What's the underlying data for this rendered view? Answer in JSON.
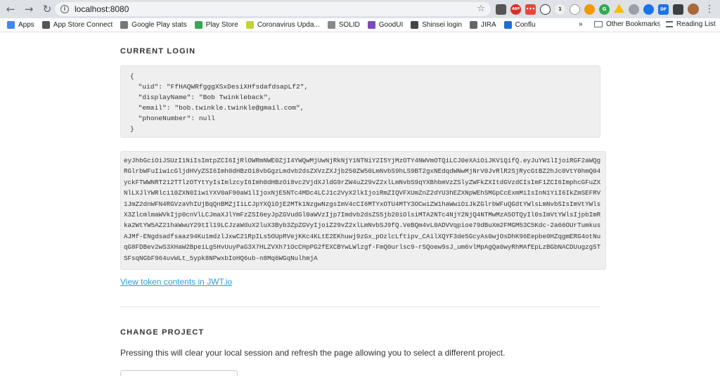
{
  "browser": {
    "url": "localhost:8080",
    "bookmarks": [
      {
        "label": "Apps",
        "color": "#4285f4"
      },
      {
        "label": "App Store Connect",
        "color": "#555555"
      },
      {
        "label": "Google Play stats",
        "color": "#777777"
      },
      {
        "label": "Play Store",
        "color": "#34a853"
      },
      {
        "label": "Coronavirus Upda...",
        "color": "#c5d23a"
      },
      {
        "label": "SOLID",
        "color": "#888888"
      },
      {
        "label": "GoodUI",
        "color": "#7b4bb8"
      },
      {
        "label": "Shinsei login",
        "color": "#444444"
      },
      {
        "label": "JIRA",
        "color": "#666666"
      },
      {
        "label": "Conflu",
        "color": "#1f6fd1"
      }
    ],
    "more_bookmarks": "»",
    "other_bookmarks": "Other Bookmarks",
    "reading_list": "Reading List",
    "ext_badge": "1",
    "ext_abp": "ABP",
    "ext_df": "DF"
  },
  "login": {
    "title": "CURRENT LOGIN",
    "json": "{\n  \"uid\": \"FfHAQWRfgggXSxDesiXHfsdafdsapLf2\",\n  \"displayName\": \"Bob Twinkleback\",\n  \"email\": \"bob.twinkle.twinkle@gmail.com\",\n  \"phoneNumber\": null\n}",
    "jwt": "eyJhbGciOiJSUzI1NiIsImtpZCI6IjRlOWRmNWE0ZjI4YWQwMjUwNjRkNjY1NTNiY2I5YjMzOTY4NWVmOTQiLCJ0eXAiOiJKV1QifQ.eyJuYW1lIjoiRGF2aWQgRGlrbWFuIiwicGljdHVyZSI6Imh0dHBzOi8vbGgzLmdvb2dsZXVzZXJjb250ZW50LmNvbS9hLS9BT2gxNEdqdWNwMjNrV0JvRlR2SjRycGtBZ2hJc0VtY0hmQ04yckFTWWNRT212TTlzOTYtYyIsImlzcyI6Imh0dHBzOi8vc2VjdXJldG9rZW4uZ29vZ2xlLmNvbS9qYXBhbmVzZSlyZWFkZXItdGVzdCIsImF1ZCI6ImphcGFuZXNlLXJlYWRlci10ZXN0IiwiYXV0aF90aW1lIjoxNjE5NTc4MDc4LCJ1c2VyX2lkIjoiRmZIQVFXUmZnZ2dYU3hEZXNpWEhSMGpCcExmMiIsInN1YiI6IkZmSEFRV1JmZ2dnWFN4RGVzaVhIUjBqQnBMZjIiLCJpYXQiOjE2MTk1NzgwNzgsImV4cCI6MTYxOTU4MTY3OCwiZW1haWwiOiJkZGlrbWFuQGdtYWlsLmNvbSIsImVtYWlsX3ZlcmlmaWVkIjp0cnVlLCJmaXJlYmFzZSI6eyJpZGVudGl0aWVzIjp7Imdvb2dsZS5jb20iOlsiMTA2NTc4NjY2NjQ4NTMwMzA5OTQyIl0sImVtYWlsIjpbImRka2WtYW5AZ21haWwuY29tIl19LCJzaWduX2luX3Byb3ZpZGVyIjoiZ29vZ2xlLmNvbSJ9fQ.VeBQm4vL0ADVVqpioe79dBuXm2FMGM53C5Kdc-2a66OUrTumkusAJMf-ENgdsadfsaaz94Ku1mdzlJxwC21RpILs5OUpRVejKKc4KLtE2EKhuwj9zGx_pOzlcLftipv_CAilXQYF3de5GcyAs0wjOsDhK96Eepbe0HZqgmERG4otNuqG8FDBev2wS3XHaW2BpeiLg5HvUuyPaG3X7HLZVXh71OcCHpPG2fEXCBYwLWlzgf-FmQ0urlsc9-rSQoew9sJ_um6vlMpAgQa0wyRhMAfEpLzBGbNACDUugzg5TSFsqNGbF964uvWLt_5ypk8NPwxbIoHQ6ub-n8Mq6WGqNulhmjA",
    "jwt_link": "View token contents in JWT.io"
  },
  "project": {
    "title": "CHANGE PROJECT",
    "description": "Pressing this will clear your local session and refresh the page allowing you to select a different project."
  }
}
